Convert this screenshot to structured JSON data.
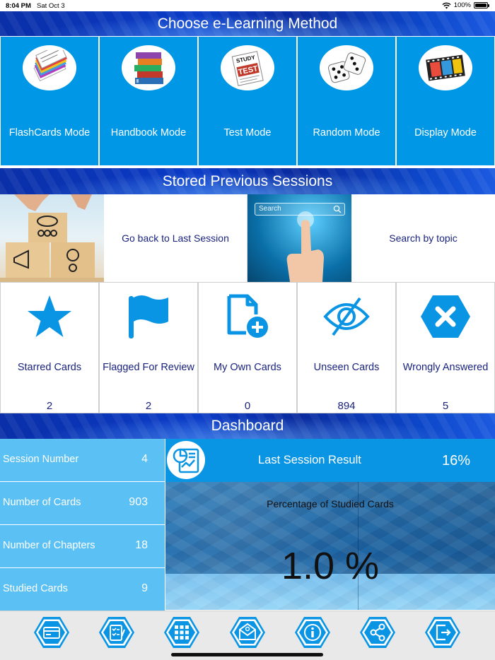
{
  "status": {
    "time": "8:04 PM",
    "date": "Sat Oct 3",
    "battery": "100%"
  },
  "sections": {
    "methods_title": "Choose e-Learning Method",
    "sessions_title": "Stored Previous Sessions",
    "dashboard_title": "Dashboard"
  },
  "modes": [
    {
      "label": "FlashCards Mode",
      "icon": "flashcards-icon"
    },
    {
      "label": "Handbook Mode",
      "icon": "books-icon"
    },
    {
      "label": "Test Mode",
      "icon": "study-test-icon"
    },
    {
      "label": "Random Mode",
      "icon": "dice-icon"
    },
    {
      "label": "Display Mode",
      "icon": "film-strip-icon"
    }
  ],
  "sessions": {
    "last_session": "Go back to Last Session",
    "search_label": "Search by topic",
    "search_placeholder": "Search"
  },
  "stats": [
    {
      "label": "Starred Cards",
      "count": "2",
      "icon": "star-icon"
    },
    {
      "label": "Flagged For Review",
      "count": "2",
      "icon": "flag-icon"
    },
    {
      "label": "My Own Cards",
      "count": "0",
      "icon": "add-document-icon"
    },
    {
      "label": "Unseen Cards",
      "count": "894",
      "icon": "eye-slash-icon"
    },
    {
      "label": "Wrongly Answered",
      "count": "5",
      "icon": "close-hexagon-icon"
    }
  ],
  "dashboard": {
    "rows": [
      {
        "label": "Session Number",
        "value": "4"
      },
      {
        "label": "Number of Cards",
        "value": "903"
      },
      {
        "label": "Number of Chapters",
        "value": "18"
      },
      {
        "label": "Studied Cards",
        "value": "9"
      }
    ],
    "last_session_result_label": "Last Session Result",
    "last_session_result_value": "16%",
    "studied_label": "Percentage of Studied Cards",
    "studied_value": "1.0 %"
  },
  "tabbar": [
    "card-icon",
    "checklist-icon",
    "grid-icon",
    "mail-icon",
    "info-icon",
    "share-icon",
    "logout-icon"
  ],
  "colors": {
    "accent": "#0098e6",
    "dark_blue": "#1a237e",
    "navy_banner": "#0b3cc8",
    "light_tile": "#5bc0f3"
  }
}
